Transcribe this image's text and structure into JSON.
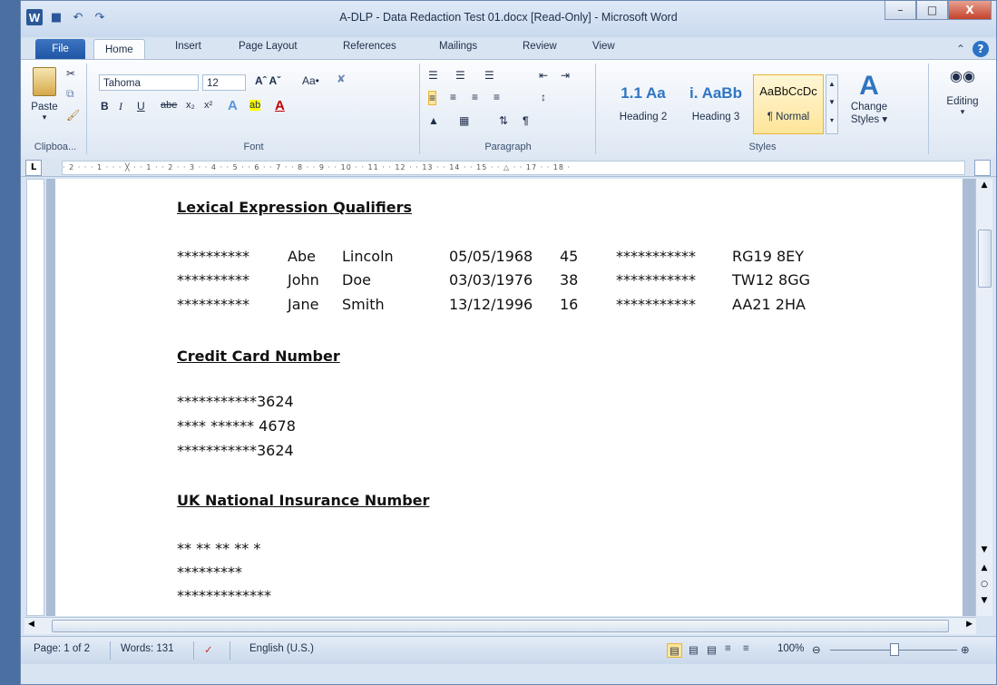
{
  "window": {
    "title": "A-DLP - Data Redaction Test 01.docx [Read-Only]  -  Microsoft Word",
    "min_label": "–",
    "max_label": "□",
    "close_label": "X"
  },
  "qat": {
    "logo": "W",
    "save_icon": "💾",
    "undo_icon": "↶",
    "redo_icon": "↷"
  },
  "tabs": [
    "File",
    "Home",
    "Insert",
    "Page Layout",
    "References",
    "Mailings",
    "Review",
    "View"
  ],
  "ribbon": {
    "clipboard": {
      "paste_label": "Paste",
      "group_label": "Clipboa..."
    },
    "font": {
      "name": "Tahoma",
      "size": "12",
      "aa_label": "Aa•",
      "group_label": "Font"
    },
    "paragraph": {
      "group_label": "Paragraph"
    },
    "styles": {
      "items": [
        {
          "sample": "1.1  Aa",
          "name": "Heading 2"
        },
        {
          "sample": "i.  AaBb",
          "name": "Heading 3"
        },
        {
          "sample": "AaBbCcDc",
          "name": "¶ Normal"
        }
      ],
      "change_label": "Change Styles ▾",
      "group_label": "Styles"
    },
    "editing": {
      "label": "Editing"
    }
  },
  "ruler": {
    "marks": "· 2 · · · 1 · · · ╳ · · 1 · · 2 · · 3 · · 4 · · 5 · · 6 · · 7 · · 8 · · 9 · · 10 · · 11 · · 12 · · 13 · · 14 · · 15 · · △ · · 17 · · 18 ·"
  },
  "document": {
    "heading1": "Lexical Expression Qualifiers",
    "rows": [
      {
        "mask": "**********",
        "first": "Abe",
        "last": "Lincoln",
        "dob": "05/05/1968",
        "age": "45",
        "pmask": "***********",
        "post": "RG19 8EY"
      },
      {
        "mask": "**********",
        "first": "John",
        "last": "Doe",
        "dob": "03/03/1976",
        "age": "38",
        "pmask": "***********",
        "post": "TW12 8GG"
      },
      {
        "mask": "**********",
        "first": "Jane",
        "last": "Smith",
        "dob": "13/12/1996",
        "age": "16",
        "pmask": "***********",
        "post": "AA21 2HA"
      }
    ],
    "heading2": "Credit Card Number",
    "cards": [
      "***********3624",
      "**** ****** 4678",
      "***********3624"
    ],
    "heading3": "UK National Insurance Number",
    "ni": [
      "** ** ** ** *",
      "*********",
      "*************"
    ]
  },
  "status": {
    "page": "Page: 1 of 2",
    "words": "Words: 131",
    "language": "English (U.S.)",
    "zoom": "100%"
  }
}
